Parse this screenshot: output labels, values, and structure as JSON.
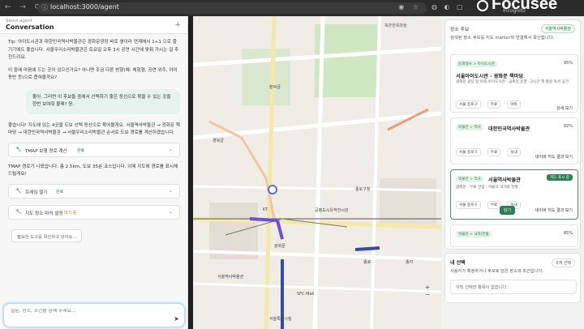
{
  "browser": {
    "url": "localhost:3000/agent",
    "brand": "Focusee",
    "incognito": "Incognito"
  },
  "left": {
    "subtitle": "Seoul agent",
    "title": "Conversation",
    "messages": [
      "Tip: 아이도시관과 대한민국역사박물관은 광화문광장 바로 옆이라 연계해서 1+1 으로 즐기기에도 좋습니다. 서울우리소리박물관은 토요일 오후 3시 공연 시간에 맞춰 가시는 걸 추천드려요.",
      "이 중에 마음에 드는 곳이 있으신가요? 아니면 조금 다른 방향(예: 체험형, 공연 위주, 야이 동반 등)으로 좁혀볼까요?"
    ],
    "user_message": "좋아. 그러면 이 후보들 중에서 선택하기 좋은 동선으로 묶을 수 있는 곳을 한번 보여줘 볼래? 응.",
    "reply1": "좋습니다! 지도에 있는 4곳을 도보 선택 동선으로 묶어볼게요. 서울역사박물관 → 광화문 책마당 → 대한민국역사박물관 → 서울우리소리박물관 순서로 도보 경로를 계산하겠습니다.",
    "tool1": {
      "label": "TMAP 보행 경로 계산",
      "status": "완료"
    },
    "reply2": "TMAP 경로가 나왔습니다. 총 2.5km, 도보 35분 코스입니다. 이제 지도에 경로를 표시해 드릴게요!",
    "tool2": {
      "label": "프레임 열기",
      "status": "완료"
    },
    "tool3": {
      "label": "지도 장소 마커 설정",
      "status": "대기 중"
    },
    "note": "필요한 도구를 확인하고 있어요...",
    "input_placeholder": "질문, 장소, 조건을 함께 주세요..."
  },
  "map": {
    "labels": [
      "북촌한옥마을",
      "창덕궁",
      "경복궁",
      "광화문",
      "종각",
      "종로",
      "서울역사박물관",
      "SFC Mall",
      "종로구청",
      "공평도시유적전시관",
      "KT",
      "서울특별시청"
    ]
  },
  "right": {
    "header": {
      "title": "장소 후보",
      "badge": "서울역사박물관",
      "desc": "검색된 장소 후보를 지도 marker와 연결해서 확인합니다."
    },
    "places": [
      {
        "cat": "문화행사 > 아이도시관",
        "pct": "95%",
        "name": "서울아이도시관 - 광화문 책마당",
        "info": "광화문 광장 앞 야외 아이도시관 · 금토일 운영 · 2시간 책 활용 독서 공간",
        "tags": [
          "서울 종로구",
          "무료",
          "야외"
        ],
        "detail": "상세 보기"
      },
      {
        "cat": "박물관 > 역사",
        "pct": "92%",
        "name": "대한민국역사박물관",
        "info": "",
        "tags": [
          "서울 종로구",
          "무료",
          "실내"
        ],
        "detail": "네이버 지도 결과 보기"
      },
      {
        "cat": "박물관 > 역사",
        "pct": "",
        "name": "서울역사박물관",
        "info": "광화문 · 무료 관람 · 서울의 과거와 현재",
        "tags": [
          "서울 종로구",
          "무료",
          "실내"
        ],
        "detail": "네이버 지도 결과 보기",
        "selected": "지도 표시 중",
        "select_btn": "담기"
      },
      {
        "cat": "박물관 > 국악/전통",
        "pct": "85%",
        "name": "",
        "info": "",
        "tags": [],
        "detail": ""
      }
    ],
    "my_selection": {
      "title": "내 선택",
      "badge": "0개 선택",
      "desc": "사용자가 확정하거나 후보로 담은 장소와 조건입니다.",
      "empty": "아직 선택한 항목이 없습니다."
    }
  },
  "colors": {
    "accent": "#2d7d57",
    "route": "#6b4de6",
    "subway": "#3949ab"
  }
}
